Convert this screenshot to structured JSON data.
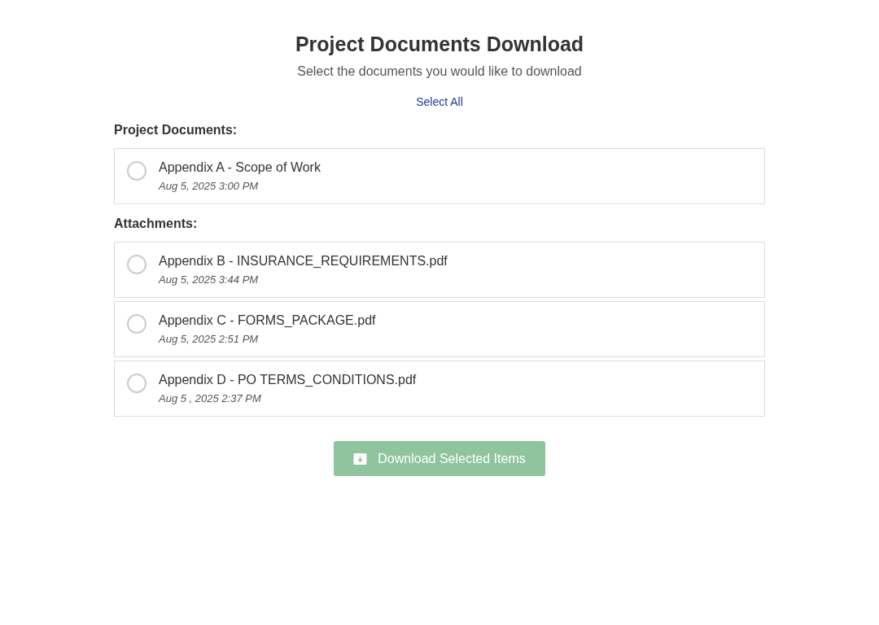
{
  "header": {
    "title": "Project Documents Download",
    "subtitle": "Select the documents you would like to download",
    "select_all": "Select All"
  },
  "sections": [
    {
      "heading": "Project Documents:",
      "items": [
        {
          "name": "Appendix A - Scope of Work",
          "date": "Aug 5, 2025 3:00 PM",
          "selected": false
        }
      ]
    },
    {
      "heading": "Attachments:",
      "items": [
        {
          "name": "Appendix B - INSURANCE_REQUIREMENTS.pdf",
          "date": "Aug 5, 2025 3:44 PM",
          "selected": false
        },
        {
          "name": "Appendix C - FORMS_PACKAGE.pdf",
          "date": "Aug 5, 2025 2:51 PM",
          "selected": false
        },
        {
          "name": "Appendix D - PO TERMS_CONDITIONS.pdf",
          "date": "Aug 5 , 2025 2:37 PM",
          "selected": false
        }
      ]
    }
  ],
  "download_button": {
    "label": "Download Selected Items",
    "disabled": true
  }
}
